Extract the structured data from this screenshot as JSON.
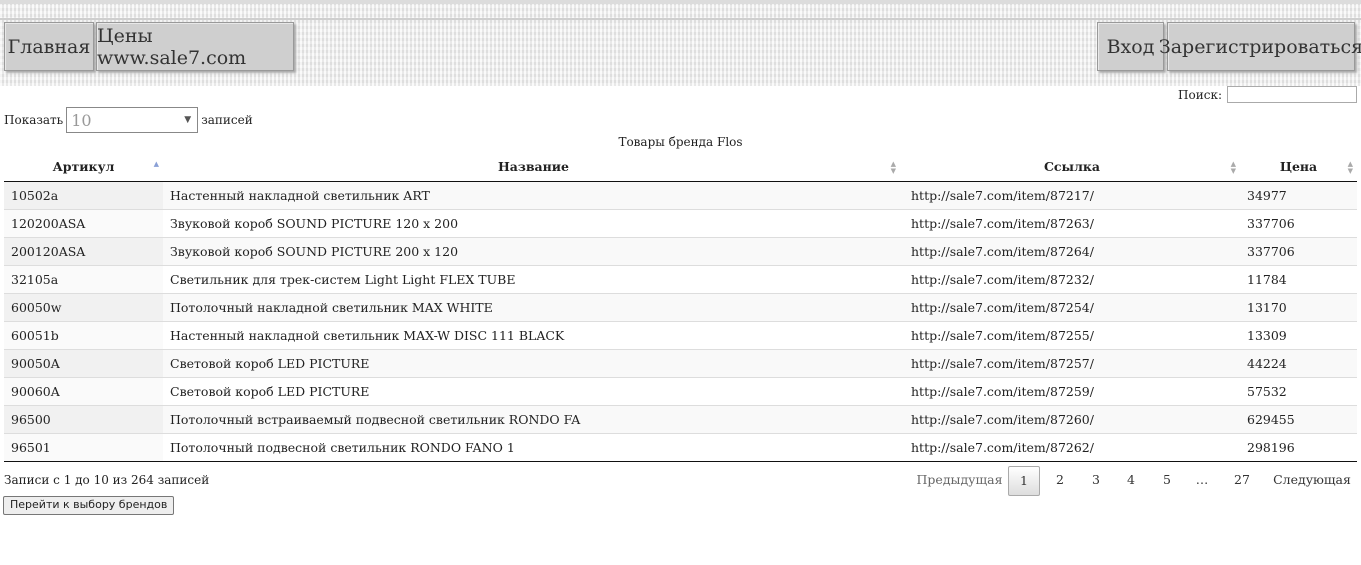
{
  "nav": {
    "home": "Главная",
    "prices": "Цены www.sale7.com",
    "login": "Вход",
    "register": "Зарегистрироваться"
  },
  "search": {
    "label": "Поиск:",
    "value": ""
  },
  "length": {
    "show_label": "Показать",
    "selected": "10",
    "records_label": "записей"
  },
  "table": {
    "caption": "Товары бренда Flos",
    "columns": [
      "Артикул",
      "Название",
      "Ссылка",
      "Цена"
    ],
    "sorted_column": "Артикул",
    "rows": [
      [
        "10502a",
        "Настенный накладной светильник ART",
        "http://sale7.com/item/87217/",
        "34977"
      ],
      [
        "120200ASA",
        "Звуковой короб SOUND PICTURE 120 x 200",
        "http://sale7.com/item/87263/",
        "337706"
      ],
      [
        "200120ASA",
        "Звуковой короб SOUND PICTURE 200 x 120",
        "http://sale7.com/item/87264/",
        "337706"
      ],
      [
        "32105a",
        "Светильник для трек-систем Light Light FLEX TUBE",
        "http://sale7.com/item/87232/",
        "11784"
      ],
      [
        "60050w",
        "Потолочный накладной светильник MAX WHITE",
        "http://sale7.com/item/87254/",
        "13170"
      ],
      [
        "60051b",
        "Настенный накладной светильник MAX-W DISC 111 BLACK",
        "http://sale7.com/item/87255/",
        "13309"
      ],
      [
        "90050A",
        "Световой короб LED PICTURE",
        "http://sale7.com/item/87257/",
        "44224"
      ],
      [
        "90060A",
        "Световой короб LED PICTURE",
        "http://sale7.com/item/87259/",
        "57532"
      ],
      [
        "96500",
        "Потолочный встраиваемый подвесной светильник RONDO FA",
        "http://sale7.com/item/87260/",
        "629455"
      ],
      [
        "96501",
        "Потолочный подвесной светильник RONDO FANO 1",
        "http://sale7.com/item/87262/",
        "298196"
      ]
    ]
  },
  "info": "Записи с 1 до 10 из 264 записей",
  "pagination": {
    "previous": "Предыдущая",
    "pages": [
      "1",
      "2",
      "3",
      "4",
      "5"
    ],
    "ellipsis": "…",
    "last": "27",
    "next": "Следующая",
    "current": "1"
  },
  "brands_button": "Перейти к выбору брендов"
}
